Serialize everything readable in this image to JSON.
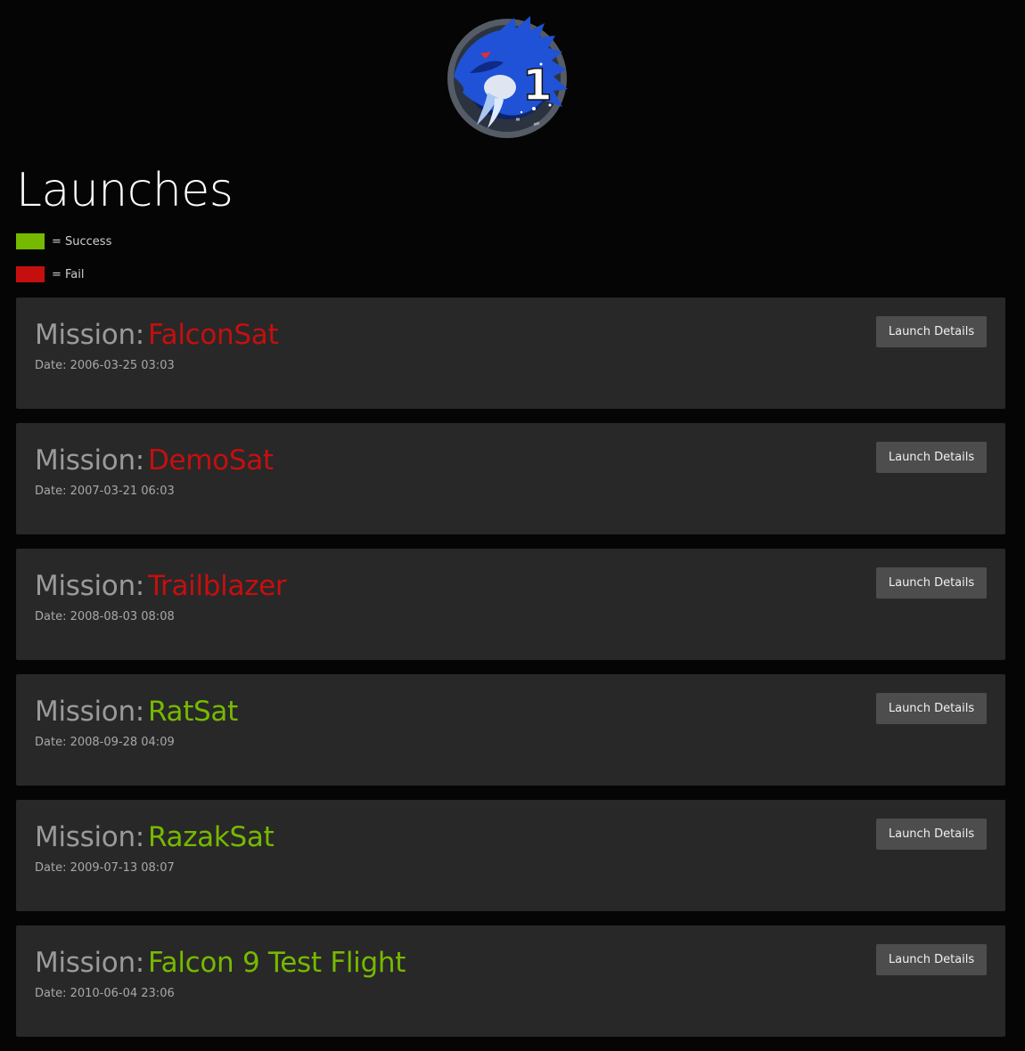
{
  "page": {
    "title": "Launches",
    "logo_icon": "crew-dragon-mission-patch-icon"
  },
  "colors": {
    "success": "#76b900",
    "fail": "#c50f0f",
    "background": "#050505",
    "card": "#282828",
    "button": "#4d4d4d"
  },
  "legend": [
    {
      "label": "= Success",
      "status": "success"
    },
    {
      "label": "= Fail",
      "status": "fail"
    }
  ],
  "mission_prefix": "Mission:",
  "details_label": "Launch Details",
  "launches": [
    {
      "name": "FalconSat",
      "date": "Date: 2006-03-25 03:03",
      "status": "fail"
    },
    {
      "name": "DemoSat",
      "date": "Date: 2007-03-21 06:03",
      "status": "fail"
    },
    {
      "name": "Trailblazer",
      "date": "Date: 2008-08-03 08:08",
      "status": "fail"
    },
    {
      "name": "RatSat",
      "date": "Date: 2008-09-28 04:09",
      "status": "success"
    },
    {
      "name": "RazakSat",
      "date": "Date: 2009-07-13 08:07",
      "status": "success"
    },
    {
      "name": "Falcon 9 Test Flight",
      "date": "Date: 2010-06-04 23:06",
      "status": "success"
    }
  ]
}
